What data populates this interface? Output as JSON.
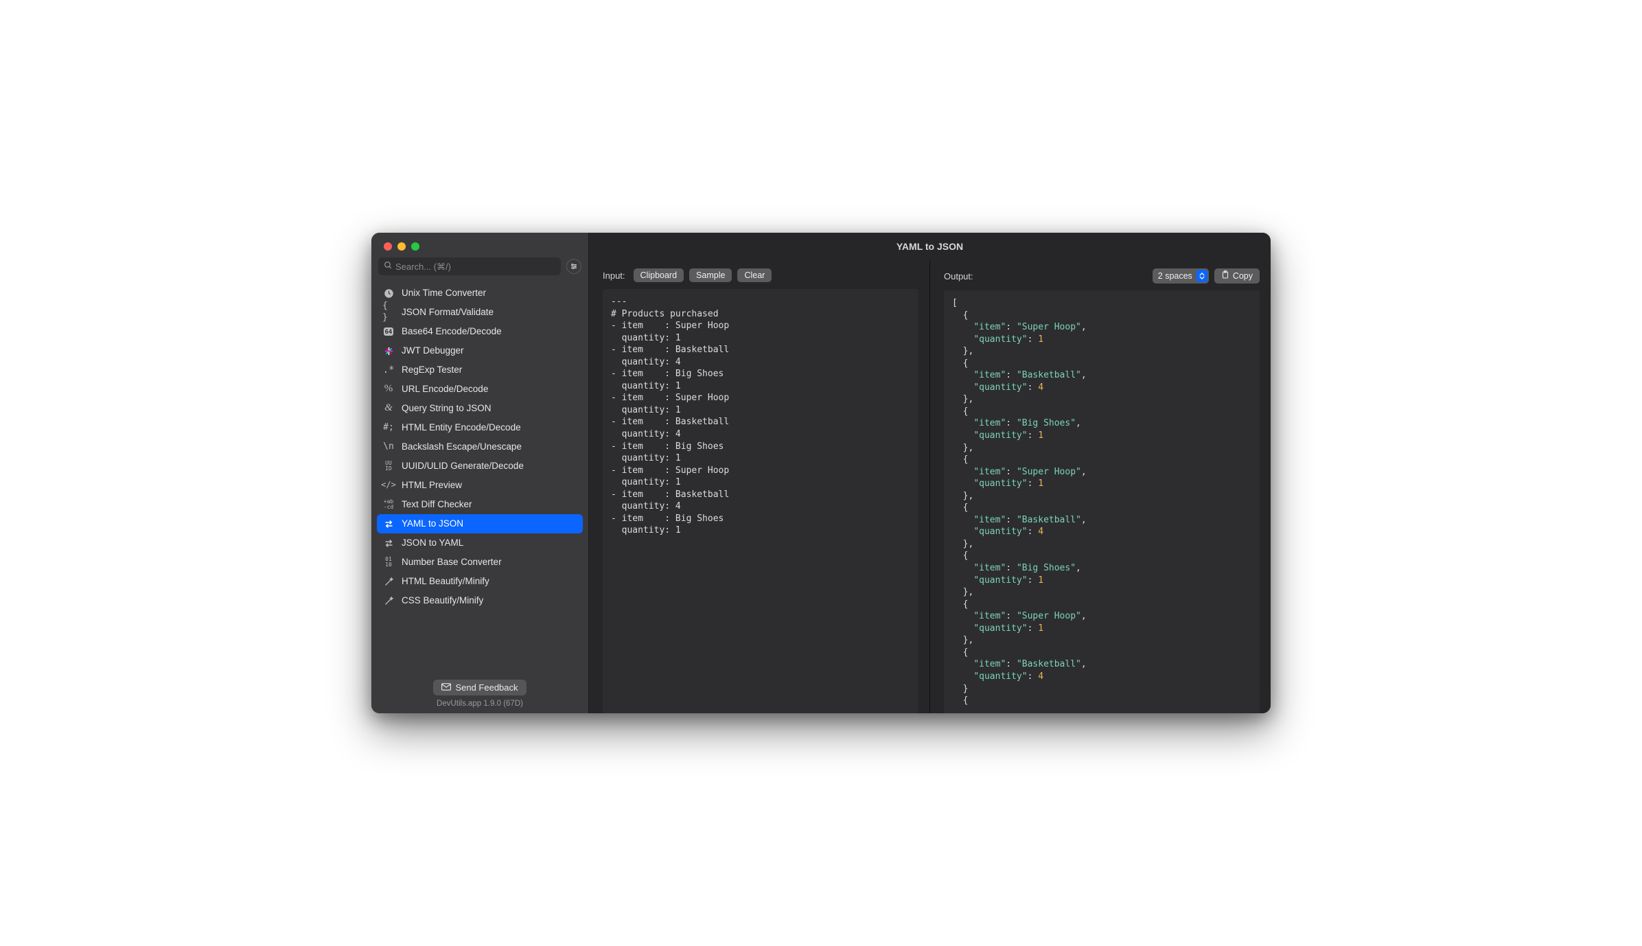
{
  "window": {
    "title": "YAML to JSON"
  },
  "search": {
    "placeholder": "Search... (⌘/)"
  },
  "sidebar": {
    "items": [
      {
        "icon": "clock",
        "label": "Unix Time Converter"
      },
      {
        "icon": "braces",
        "label": "JSON Format/Validate"
      },
      {
        "icon": "b64",
        "label": "Base64 Encode/Decode"
      },
      {
        "icon": "jwt",
        "label": "JWT Debugger"
      },
      {
        "icon": "regex",
        "label": "RegExp Tester"
      },
      {
        "icon": "percent",
        "label": "URL Encode/Decode"
      },
      {
        "icon": "amp",
        "label": "Query String to JSON"
      },
      {
        "icon": "hash",
        "label": "HTML Entity Encode/Decode"
      },
      {
        "icon": "backslash",
        "label": "Backslash Escape/Unescape"
      },
      {
        "icon": "uuid",
        "label": "UUID/ULID Generate/Decode"
      },
      {
        "icon": "tag",
        "label": "HTML Preview"
      },
      {
        "icon": "abcd",
        "label": "Text Diff Checker"
      },
      {
        "icon": "swap",
        "label": "YAML to JSON",
        "selected": true
      },
      {
        "icon": "swap",
        "label": "JSON to YAML"
      },
      {
        "icon": "binary",
        "label": "Number Base Converter"
      },
      {
        "icon": "wand",
        "label": "HTML Beautify/Minify"
      },
      {
        "icon": "wand",
        "label": "CSS Beautify/Minify"
      }
    ],
    "feedback_label": "Send Feedback",
    "version": "DevUtils.app 1.9.0 (67D)"
  },
  "input": {
    "label": "Input:",
    "buttons": {
      "clipboard": "Clipboard",
      "sample": "Sample",
      "clear": "Clear"
    },
    "content": "---\n# Products purchased\n- item    : Super Hoop\n  quantity: 1\n- item    : Basketball\n  quantity: 4\n- item    : Big Shoes\n  quantity: 1\n- item    : Super Hoop\n  quantity: 1\n- item    : Basketball\n  quantity: 4\n- item    : Big Shoes\n  quantity: 1\n- item    : Super Hoop\n  quantity: 1\n- item    : Basketball\n  quantity: 4\n- item    : Big Shoes\n  quantity: 1"
  },
  "output": {
    "label": "Output:",
    "indent_option": "2 spaces",
    "copy_label": "Copy",
    "json": [
      {
        "item": "Super Hoop",
        "quantity": 1
      },
      {
        "item": "Basketball",
        "quantity": 4
      },
      {
        "item": "Big Shoes",
        "quantity": 1
      },
      {
        "item": "Super Hoop",
        "quantity": 1
      },
      {
        "item": "Basketball",
        "quantity": 4
      },
      {
        "item": "Big Shoes",
        "quantity": 1
      },
      {
        "item": "Super Hoop",
        "quantity": 1
      },
      {
        "item": "Basketball",
        "quantity": 4
      }
    ]
  }
}
